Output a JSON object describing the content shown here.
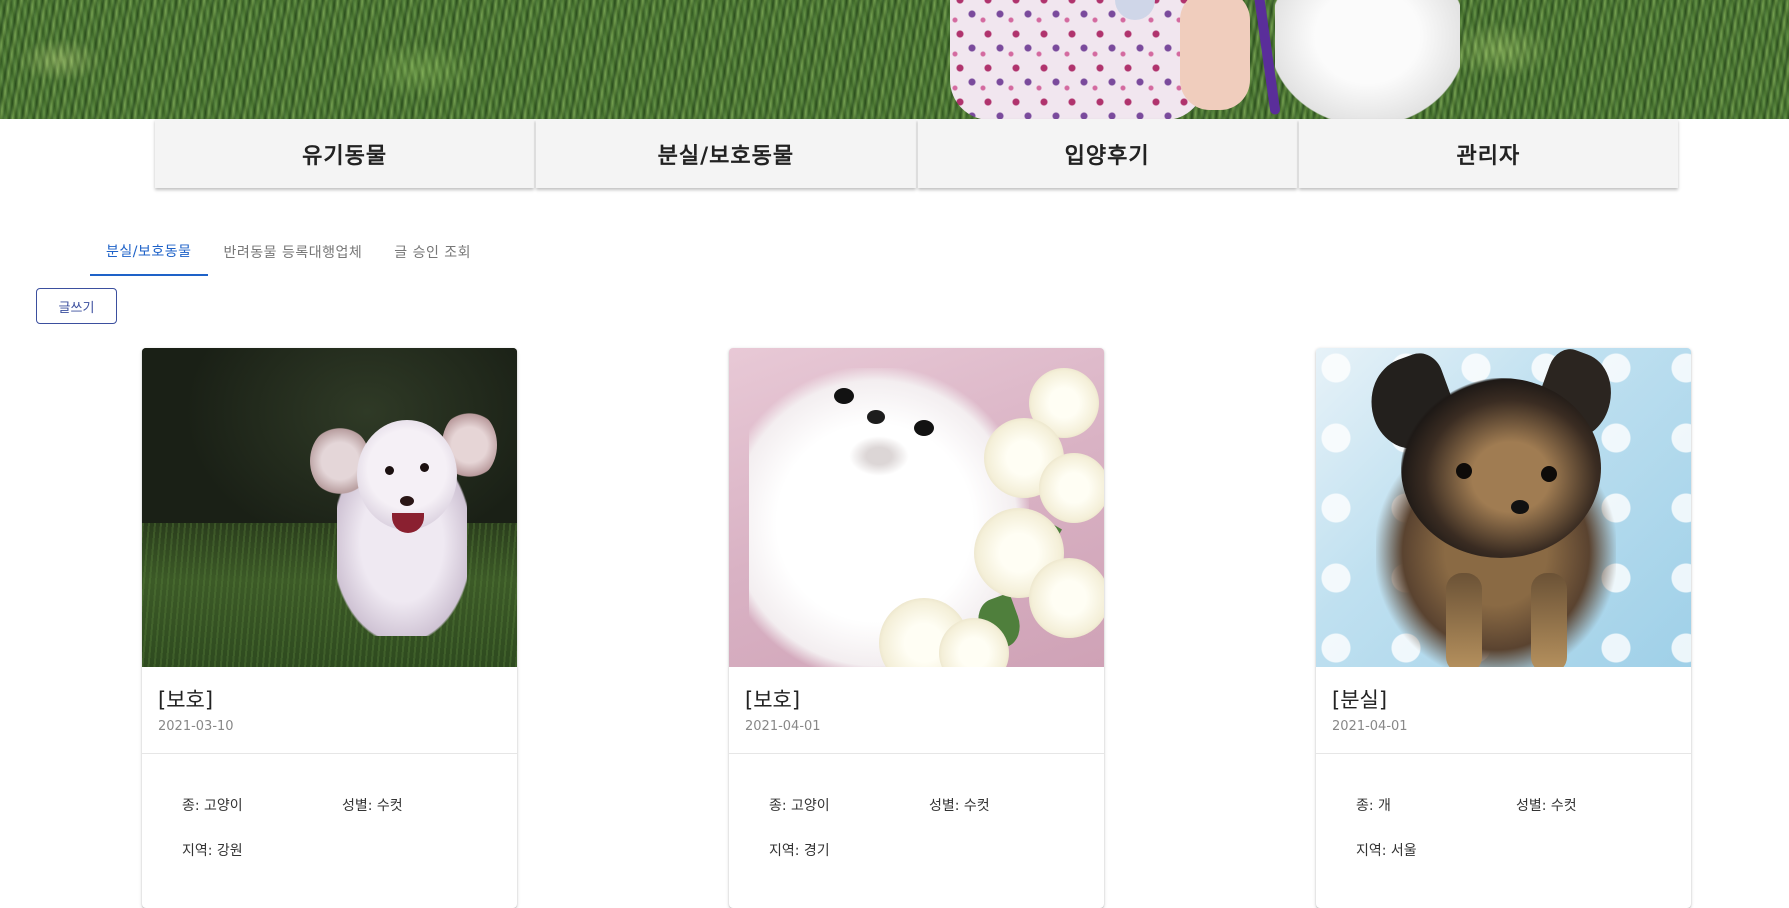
{
  "nav": {
    "items": [
      "유기동물",
      "분실/보호동물",
      "입양후기",
      "관리자"
    ]
  },
  "tabs": [
    "분실/보호동물",
    "반려동물 등록대행업체",
    "글 승인 조회"
  ],
  "write_button": "글쓰기",
  "cards": [
    {
      "title": "[보호]",
      "date": "2021-03-10",
      "species": "종: 고양이",
      "sex": "성별: 수컷",
      "region": "지역: 강원"
    },
    {
      "title": "[보호]",
      "date": "2021-04-01",
      "species": "종: 고양이",
      "sex": "성별: 수컷",
      "region": "지역: 경기"
    },
    {
      "title": "[분실]",
      "date": "2021-04-01",
      "species": "종: 개",
      "sex": "성별: 수컷",
      "region": "지역: 서울"
    }
  ],
  "colors": {
    "accent": "#1e62c8",
    "button_border": "#3b4f9e",
    "nav_bg": "#f4f4f4"
  }
}
